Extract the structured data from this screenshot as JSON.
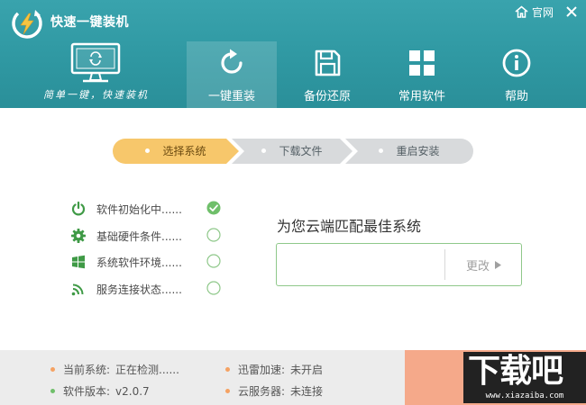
{
  "header": {
    "app_title": "快速一键装机",
    "site_link": "官网",
    "slogan": "简单一键，快速装机"
  },
  "nav": {
    "tabs": [
      {
        "label": "一键重装",
        "icon": "refresh-icon",
        "active": true
      },
      {
        "label": "备份还原",
        "icon": "floppy-disk-icon",
        "active": false
      },
      {
        "label": "常用软件",
        "icon": "app-grid-icon",
        "active": false
      },
      {
        "label": "帮助",
        "icon": "info-icon",
        "active": false
      }
    ]
  },
  "steps": [
    {
      "label": "选择系统",
      "active": true
    },
    {
      "label": "下载文件",
      "active": false
    },
    {
      "label": "重启安装",
      "active": false
    }
  ],
  "checklist": [
    {
      "label": "软件初始化中......",
      "icon": "power-icon",
      "done": true
    },
    {
      "label": "基础硬件条件......",
      "icon": "gear-icon",
      "done": false
    },
    {
      "label": "系统软件环境......",
      "icon": "windows-logo-icon",
      "done": false
    },
    {
      "label": "服务连接状态......",
      "icon": "wifi-icon",
      "done": false
    }
  ],
  "recommend": {
    "title": "为您云端匹配最佳系统",
    "system_value": "",
    "change_label": "更改"
  },
  "footer": {
    "current_os_label": "当前系统:",
    "current_os_value": "正在检测......",
    "version_label": "软件版本:",
    "version_value": "v2.0.7",
    "thunder_label": "迅雷加速:",
    "thunder_value": "未开启",
    "cloud_label": "云服务器:",
    "cloud_value": "未连接"
  },
  "watermark": {
    "logo_text": "下载吧",
    "url": "www.xiazaiba.com"
  },
  "colors": {
    "header_teal": "#2f98a2",
    "step_active": "#f7c76b",
    "step_inactive": "#d8dadc",
    "accent_green": "#6fbf6a",
    "accent_orange": "#f5a263"
  }
}
